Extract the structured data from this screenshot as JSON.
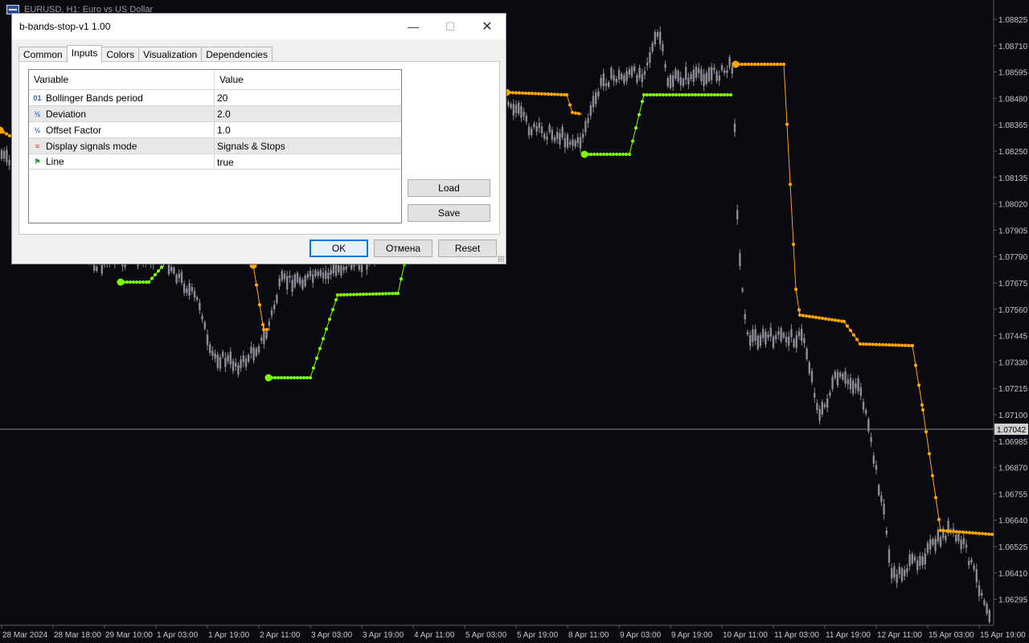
{
  "chart": {
    "title": "EURUSD, H1:  Euro vs US Dollar",
    "current_price": "1.07042",
    "price_labels": [
      "1.08825",
      "1.08710",
      "1.08595",
      "1.08480",
      "1.08365",
      "1.08250",
      "1.08135",
      "1.08020",
      "1.07905",
      "1.07790",
      "1.07675",
      "1.07560",
      "1.07445",
      "1.07330",
      "1.07215",
      "1.07100",
      "1.06985",
      "1.06870",
      "1.06755",
      "1.06640",
      "1.06525",
      "1.06410",
      "1.06295"
    ],
    "time_labels": [
      "28 Mar 2024",
      "28 Mar 18:00",
      "29 Mar 10:00",
      "1 Apr 03:00",
      "1 Apr 19:00",
      "2 Apr 11:00",
      "3 Apr 03:00",
      "3 Apr 19:00",
      "4 Apr 11:00",
      "5 Apr 03:00",
      "5 Apr 19:00",
      "8 Apr 11:00",
      "9 Apr 03:00",
      "9 Apr 19:00",
      "10 Apr 11:00",
      "11 Apr 03:00",
      "11 Apr 19:00",
      "12 Apr 11:00",
      "15 Apr 03:00",
      "15 Apr 19:00"
    ],
    "colors": {
      "background": "#0a0a10",
      "candle": "#8c8c94",
      "stop_up": "#7cfc00",
      "stop_down": "#ffa500",
      "axis_text": "#c8c8c8",
      "crosshair": "#b0b0b0"
    }
  },
  "dialog": {
    "title": "b-bands-stop-v1 1.00",
    "tabs": [
      {
        "label": "Common",
        "active": false
      },
      {
        "label": "Inputs",
        "active": true
      },
      {
        "label": "Colors",
        "active": false
      },
      {
        "label": "Visualization",
        "active": false
      },
      {
        "label": "Dependencies",
        "active": false
      }
    ],
    "grid_headers": {
      "variable": "Variable",
      "value": "Value"
    },
    "inputs": [
      {
        "icon": "integer-icon",
        "glyph": "01",
        "variable": "Bollinger Bands period",
        "value": "20"
      },
      {
        "icon": "fraction-icon",
        "glyph": "½",
        "variable": "Deviation",
        "value": "2.0"
      },
      {
        "icon": "fraction-icon",
        "glyph": "½",
        "variable": "Offset Factor",
        "value": "1.0"
      },
      {
        "icon": "enum-icon",
        "glyph": "≡",
        "variable": "Display signals mode",
        "value": "Signals & Stops"
      },
      {
        "icon": "flag-icon",
        "glyph": "⚑",
        "variable": "Line",
        "value": "true"
      }
    ],
    "buttons": {
      "load": "Load",
      "save": "Save",
      "ok": "OK",
      "cancel": "Отмена",
      "reset": "Reset"
    }
  }
}
